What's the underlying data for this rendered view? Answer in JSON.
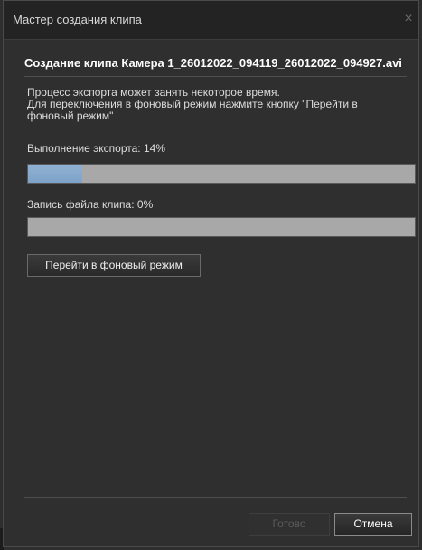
{
  "window": {
    "title": "Мастер создания клипа",
    "close_glyph": "×"
  },
  "clip": {
    "title": "Создание клипа Камера 1_26012022_094119_26012022_094927.avi"
  },
  "description": {
    "line1": "Процесс экспорта может занять некоторое время.",
    "line2": "Для переключения в фоновый режим нажмите кнопку \"Перейти в",
    "line3": "фоновый режим\""
  },
  "export_progress": {
    "label": "Выполнение экспорта: 14%",
    "percent": 14
  },
  "file_progress": {
    "label": "Запись файла клипа: 0%",
    "percent": 0
  },
  "buttons": {
    "background_mode": "Перейти в фоновый режим",
    "done": "Готово",
    "cancel": "Отмена"
  },
  "colors": {
    "progress_fill": "#86a9cd",
    "progress_track": "#a8a8a8",
    "window_bg": "#2f2f2f"
  },
  "icons": {
    "close": "close-icon"
  }
}
